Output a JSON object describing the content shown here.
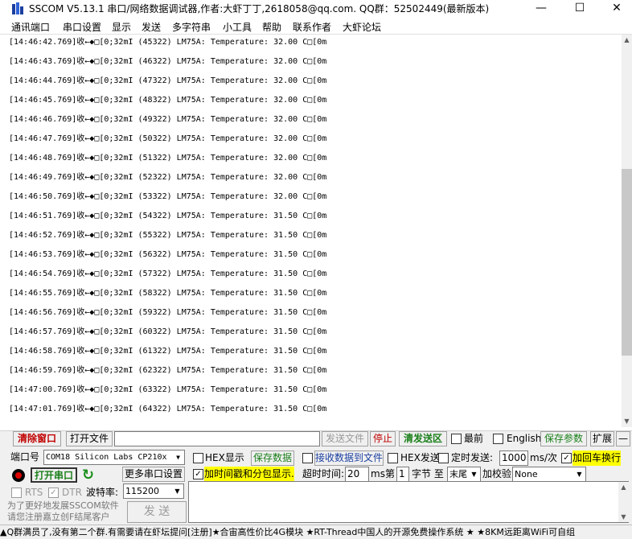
{
  "window": {
    "title": "SSCOM V5.13.1 串口/网络数据调试器,作者:大虾丁丁,2618058@qq.com. QQ群：52502449(最新版本)",
    "minimize": "—",
    "maximize": "☐",
    "close": "✕"
  },
  "menu": [
    "通讯端口",
    "串口设置",
    "显示",
    "发送",
    "多字符串",
    "小工具",
    "帮助",
    "联系作者",
    "大虾论坛"
  ],
  "log": [
    "[14:46:42.769]收←◆□[0;32mI (45322) LM75A: Temperature: 32.00 C□[0m",
    "[14:46:43.769]收←◆□[0;32mI (46322) LM75A: Temperature: 32.00 C□[0m",
    "[14:46:44.769]收←◆□[0;32mI (47322) LM75A: Temperature: 32.00 C□[0m",
    "[14:46:45.769]收←◆□[0;32mI (48322) LM75A: Temperature: 32.00 C□[0m",
    "[14:46:46.769]收←◆□[0;32mI (49322) LM75A: Temperature: 32.00 C□[0m",
    "[14:46:47.769]收←◆□[0;32mI (50322) LM75A: Temperature: 32.00 C□[0m",
    "[14:46:48.769]收←◆□[0;32mI (51322) LM75A: Temperature: 32.00 C□[0m",
    "[14:46:49.769]收←◆□[0;32mI (52322) LM75A: Temperature: 32.00 C□[0m",
    "[14:46:50.769]收←◆□[0;32mI (53322) LM75A: Temperature: 32.00 C□[0m",
    "[14:46:51.769]收←◆□[0;32mI (54322) LM75A: Temperature: 31.50 C□[0m",
    "[14:46:52.769]收←◆□[0;32mI (55322) LM75A: Temperature: 31.50 C□[0m",
    "[14:46:53.769]收←◆□[0;32mI (56322) LM75A: Temperature: 31.50 C□[0m",
    "[14:46:54.769]收←◆□[0;32mI (57322) LM75A: Temperature: 31.50 C□[0m",
    "[14:46:55.769]收←◆□[0;32mI (58322) LM75A: Temperature: 31.50 C□[0m",
    "[14:46:56.769]收←◆□[0;32mI (59322) LM75A: Temperature: 31.50 C□[0m",
    "[14:46:57.769]收←◆□[0;32mI (60322) LM75A: Temperature: 31.50 C□[0m",
    "[14:46:58.769]收←◆□[0;32mI (61322) LM75A: Temperature: 31.50 C□[0m",
    "[14:46:59.769]收←◆□[0;32mI (62322) LM75A: Temperature: 31.50 C□[0m",
    "[14:47:00.769]收←◆□[0;32mI (63322) LM75A: Temperature: 31.50 C□[0m",
    "[14:47:01.769]收←◆□[0;32mI (64322) LM75A: Temperature: 31.50 C□[0m"
  ],
  "toolbar": {
    "clear_window": "清除窗口",
    "open_file": "打开文件",
    "file_path": "",
    "send_file": "发送文件",
    "stop": "停止",
    "clear_send": "清发送区",
    "topmost": "最前",
    "english": "English",
    "save_params": "保存参数",
    "expand": "扩展",
    "dash": "—"
  },
  "port": {
    "label": "端口号",
    "value": "COM18 Silicon Labs CP210x",
    "open_button": "打开串口",
    "more_settings": "更多串口设置",
    "rts": "RTS",
    "dtr": "DTR",
    "baud_label": "波特率:",
    "baud_value": "115200"
  },
  "options": {
    "hex_display": "HEX显示",
    "save_data": "保存数据",
    "recv_to_file": "接收数据到文件",
    "hex_send": "HEX发送",
    "timed_send": "定时发送:",
    "interval": "1000",
    "interval_unit": "ms/次",
    "add_crlf": "加回车换行",
    "timestamp": "加时间戳和分包显示.",
    "timeout_label": "超时时间:",
    "timeout_value": "20",
    "timeout_unit": "ms",
    "byte_index_label": "第",
    "byte_index": "1",
    "byte_label": "字节 至",
    "byte_to": "末尾",
    "checksum_label": "加校验",
    "checksum_value": "None"
  },
  "promo": {
    "line1": "为了更好地发展SSCOM软件",
    "line2": "请您注册嘉立创F结尾客户",
    "send": "发 送"
  },
  "status": "▲Q群满员了,没有第二个群.有需要请在虾坛提问[注册]★合宙高性价比4G模块 ★RT-Thread中国人的开源免费操作系统 ★ ★8KM远距离WiFi可自组"
}
